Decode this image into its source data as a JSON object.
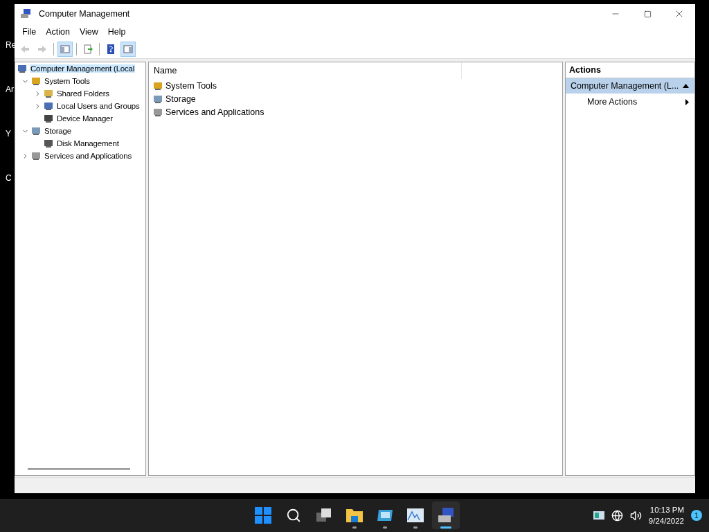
{
  "desktop_labels": [
    "Re",
    "Ar",
    "Y",
    "C"
  ],
  "window": {
    "title": "Computer Management"
  },
  "menu": [
    "File",
    "Action",
    "View",
    "Help"
  ],
  "toolbar": [
    {
      "disabled": true,
      "selected": false
    },
    {
      "disabled": true,
      "selected": false
    },
    {
      "disabled": false,
      "selected": true
    },
    {
      "disabled": false,
      "selected": false
    },
    {
      "disabled": false,
      "selected": false
    },
    {
      "disabled": false,
      "selected": true
    }
  ],
  "tree": {
    "label": "Computer Management (Local",
    "selected": true,
    "children": [
      {
        "label": "System Tools",
        "expanded": true,
        "children": [
          {
            "label": "Shared Folders",
            "expanded": false
          },
          {
            "label": "Local Users and Groups",
            "expanded": false
          },
          {
            "label": "Device Manager"
          }
        ]
      },
      {
        "label": "Storage",
        "expanded": true,
        "children": [
          {
            "label": "Disk Management"
          }
        ]
      },
      {
        "label": "Services and Applications",
        "expanded": false
      }
    ]
  },
  "list": {
    "columns": [
      "Name"
    ],
    "rows": [
      "System Tools",
      "Storage",
      "Services and Applications"
    ]
  },
  "actions": {
    "title": "Actions",
    "section": "Computer Management (L...",
    "items": [
      "More Actions"
    ]
  },
  "taskbar": {
    "apps": [
      {
        "running": false,
        "selected": false
      },
      {
        "running": false,
        "selected": false
      },
      {
        "running": false,
        "selected": false
      },
      {
        "running": true,
        "selected": false
      },
      {
        "running": true,
        "selected": false
      },
      {
        "running": true,
        "selected": false
      },
      {
        "running": true,
        "selected": true
      }
    ],
    "time": "10:13 PM",
    "date": "9/24/2022",
    "notifications": "1"
  }
}
